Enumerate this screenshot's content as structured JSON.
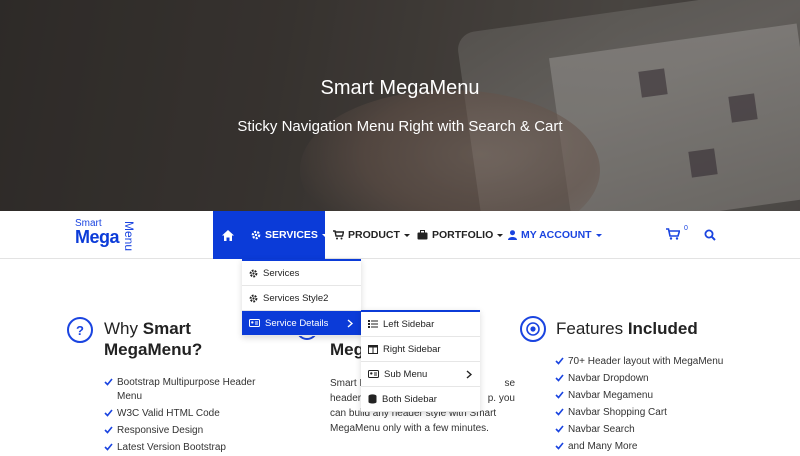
{
  "hero": {
    "title": "Smart MegaMenu",
    "subtitle": "Sticky Navigation Menu Right with Search & Cart"
  },
  "logo": {
    "smart": "Smart",
    "mega": "Mega",
    "menu": "Menu"
  },
  "nav": {
    "services": "SERVICES",
    "product": "PRODUCT",
    "portfolio": "PORTFOLIO",
    "account": "MY ACCOUNT",
    "cart_count": "0"
  },
  "dropdown": {
    "items": [
      "Services",
      "Services Style2",
      "Service Details"
    ]
  },
  "submenu": {
    "items": [
      "Left Sidebar",
      "Right Sidebar",
      "Sub Menu",
      "Both Sidebar"
    ]
  },
  "why": {
    "icon": "?",
    "title_plain": "Why ",
    "title_bold": "Smart",
    "title_line2": "MegaMenu?",
    "items": [
      "Bootstrap Multipurpose Header Menu",
      "W3C Valid HTML Code",
      "Responsive Design",
      "Latest Version Bootstrap"
    ]
  },
  "middle": {
    "heading": "Meg",
    "para_line1": "Smart M",
    "para_line1_end": "se",
    "para_line2": "header",
    "para_line2_end": "p. you",
    "para_line3": "can build any header style with Smart",
    "para_line4": "MegaMenu only with a few minutes."
  },
  "features": {
    "title_plain": "Features ",
    "title_bold": "Included",
    "items": [
      "70+ Header layout with MegaMenu",
      "Navbar Dropdown",
      "Navbar Megamenu",
      "Navbar Shopping Cart",
      "Navbar Search",
      "and Many More"
    ]
  },
  "colors": {
    "brand": "#0b3bd8",
    "accent": "#1a44e0"
  }
}
